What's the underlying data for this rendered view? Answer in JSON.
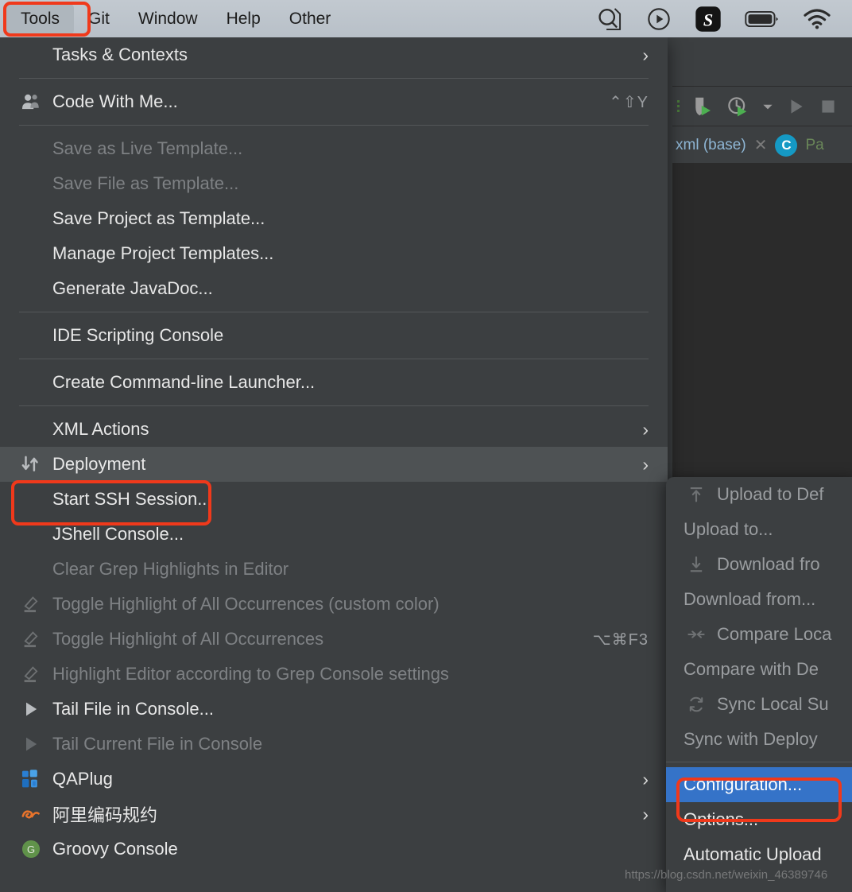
{
  "menubar": {
    "items": [
      {
        "label": "Tools",
        "active": true
      },
      {
        "label": "Git",
        "active": false
      },
      {
        "label": "Window",
        "active": false
      },
      {
        "label": "Help",
        "active": false
      },
      {
        "label": "Other",
        "active": false
      }
    ],
    "status_icons": [
      {
        "name": "spotlight-search-icon"
      },
      {
        "name": "control-center-play-icon"
      },
      {
        "name": "s-app-icon",
        "label": "S"
      },
      {
        "name": "battery-icon"
      },
      {
        "name": "wifi-icon"
      }
    ]
  },
  "highlights": {
    "accent_red": "#f0391b",
    "selection_blue": "#3573c8"
  },
  "tools_menu": {
    "groups": [
      {
        "items": [
          {
            "label": "Tasks & Contexts",
            "icon": "",
            "shortcut": "",
            "arrow": true,
            "disabled": false,
            "hover": false
          }
        ]
      },
      {
        "items": [
          {
            "label": "Code With Me...",
            "icon": "people-icon",
            "shortcut": "⌃⇧Y",
            "arrow": false,
            "disabled": false,
            "hover": false
          }
        ]
      },
      {
        "items": [
          {
            "label": "Save as Live Template...",
            "icon": "",
            "shortcut": "",
            "arrow": false,
            "disabled": true,
            "hover": false
          },
          {
            "label": "Save File as Template...",
            "icon": "",
            "shortcut": "",
            "arrow": false,
            "disabled": true,
            "hover": false
          },
          {
            "label": "Save Project as Template...",
            "icon": "",
            "shortcut": "",
            "arrow": false,
            "disabled": false,
            "hover": false
          },
          {
            "label": "Manage Project Templates...",
            "icon": "",
            "shortcut": "",
            "arrow": false,
            "disabled": false,
            "hover": false
          },
          {
            "label": "Generate JavaDoc...",
            "icon": "",
            "shortcut": "",
            "arrow": false,
            "disabled": false,
            "hover": false
          }
        ]
      },
      {
        "items": [
          {
            "label": "IDE Scripting Console",
            "icon": "",
            "shortcut": "",
            "arrow": false,
            "disabled": false,
            "hover": false
          }
        ]
      },
      {
        "items": [
          {
            "label": "Create Command-line Launcher...",
            "icon": "",
            "shortcut": "",
            "arrow": false,
            "disabled": false,
            "hover": false
          }
        ]
      },
      {
        "items": [
          {
            "label": "XML Actions",
            "icon": "",
            "shortcut": "",
            "arrow": true,
            "disabled": false,
            "hover": false
          },
          {
            "label": "Deployment",
            "icon": "deployment-arrows-icon",
            "shortcut": "",
            "arrow": true,
            "disabled": false,
            "hover": true
          },
          {
            "label": "Start SSH Session...",
            "icon": "",
            "shortcut": "",
            "arrow": false,
            "disabled": false,
            "hover": false
          },
          {
            "label": "JShell Console...",
            "icon": "",
            "shortcut": "",
            "arrow": false,
            "disabled": false,
            "hover": false
          },
          {
            "label": "Clear Grep Highlights in Editor",
            "icon": "",
            "shortcut": "",
            "arrow": false,
            "disabled": true,
            "hover": false
          },
          {
            "label": "Toggle Highlight of All Occurrences (custom color)",
            "icon": "marker-icon",
            "shortcut": "",
            "arrow": false,
            "disabled": true,
            "hover": false
          },
          {
            "label": "Toggle Highlight of All Occurrences",
            "icon": "marker-icon",
            "shortcut": "⌥⌘F3",
            "arrow": false,
            "disabled": true,
            "hover": false
          },
          {
            "label": "Highlight Editor according to Grep Console settings",
            "icon": "marker-icon",
            "shortcut": "",
            "arrow": false,
            "disabled": true,
            "hover": false
          },
          {
            "label": "Tail File in Console...",
            "icon": "play-triangle-icon",
            "shortcut": "",
            "arrow": false,
            "disabled": false,
            "hover": false
          },
          {
            "label": "Tail Current File in Console",
            "icon": "play-triangle-icon",
            "shortcut": "",
            "arrow": false,
            "disabled": true,
            "hover": false
          },
          {
            "label": "QAPlug",
            "icon": "qaplug-icon",
            "shortcut": "",
            "arrow": true,
            "disabled": false,
            "hover": false
          },
          {
            "label": "阿里编码规约",
            "icon": "alibaba-icon",
            "shortcut": "",
            "arrow": true,
            "disabled": false,
            "hover": false
          },
          {
            "label": "Groovy Console",
            "icon": "groovy-icon",
            "shortcut": "",
            "arrow": false,
            "disabled": false,
            "hover": false
          }
        ]
      }
    ]
  },
  "deployment_submenu": {
    "items": [
      {
        "label": "Upload to Def",
        "icon": "upload-icon",
        "selected": false,
        "separator_before": false
      },
      {
        "label": "Upload to...",
        "icon": "",
        "selected": false,
        "separator_before": false
      },
      {
        "label": "Download fro",
        "icon": "download-icon",
        "selected": false,
        "separator_before": false
      },
      {
        "label": "Download from...",
        "icon": "",
        "selected": false,
        "separator_before": false
      },
      {
        "label": "Compare Loca",
        "icon": "compare-icon",
        "selected": false,
        "separator_before": false
      },
      {
        "label": "Compare with De",
        "icon": "",
        "selected": false,
        "separator_before": false
      },
      {
        "label": "Sync Local Su",
        "icon": "sync-icon",
        "selected": false,
        "separator_before": false
      },
      {
        "label": "Sync with Deploy",
        "icon": "",
        "selected": false,
        "separator_before": false
      },
      {
        "label": "Configuration...",
        "icon": "",
        "selected": true,
        "separator_before": true
      },
      {
        "label": "Options...",
        "icon": "",
        "selected": false,
        "separator_before": false
      },
      {
        "label": "Automatic Upload",
        "icon": "",
        "selected": false,
        "separator_before": false
      }
    ]
  },
  "ide": {
    "tab_label": "xml (base)",
    "tab_close": "✕",
    "class_badge": "C",
    "class_name": "Pa"
  },
  "watermark": "https://blog.csdn.net/weixin_46389746"
}
